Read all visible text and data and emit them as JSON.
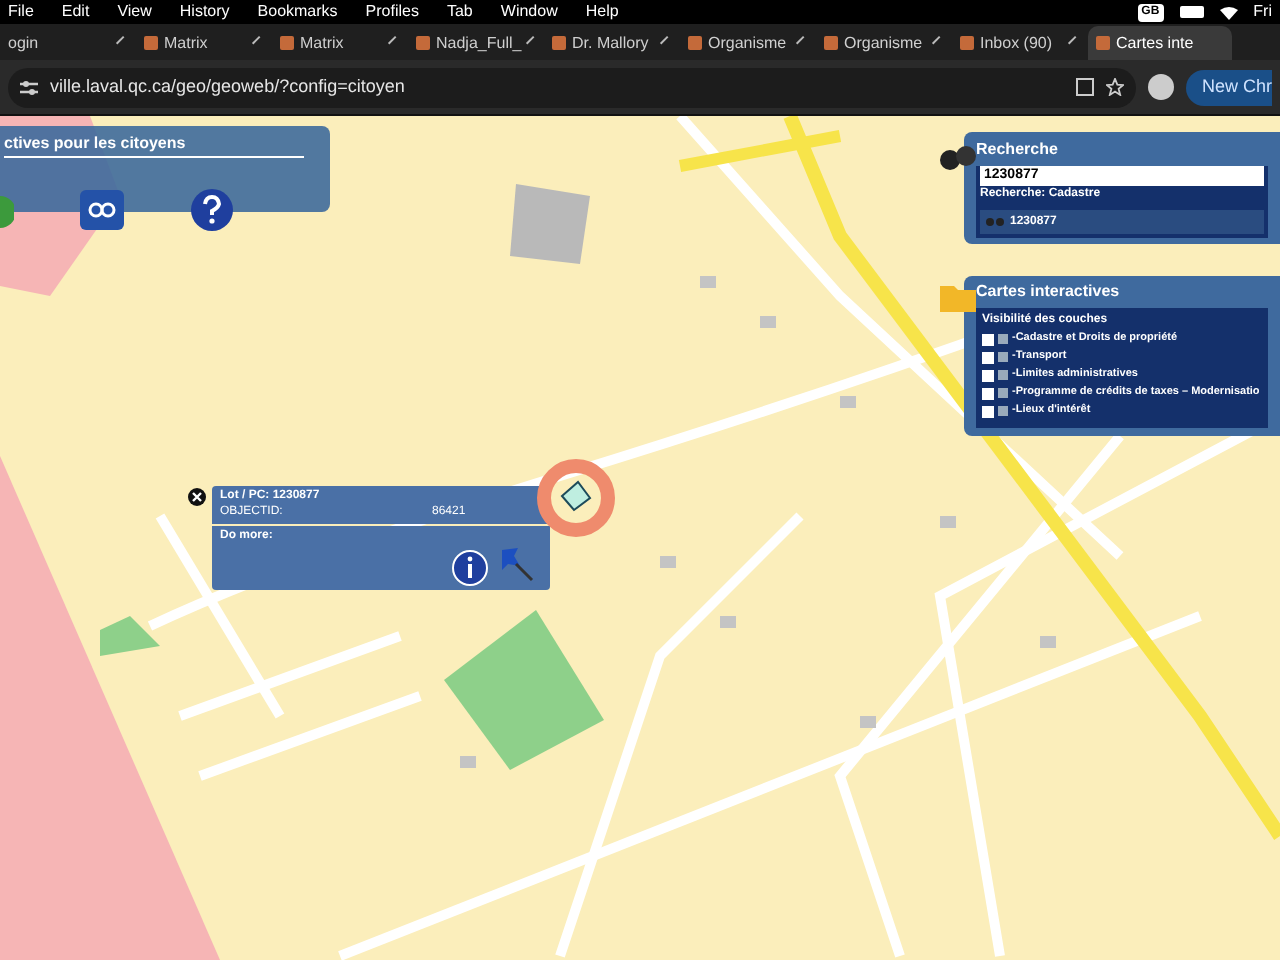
{
  "menu_bar": {
    "items": [
      "File",
      "Edit",
      "View",
      "History",
      "Bookmarks",
      "Profiles",
      "Tab",
      "Window",
      "Help"
    ],
    "input_source": "GB",
    "clock": "Fri"
  },
  "tabs": [
    {
      "label": "ogin",
      "selected": false
    },
    {
      "label": "Matrix",
      "selected": false
    },
    {
      "label": "Matrix",
      "selected": false
    },
    {
      "label": "Nadja_Full_",
      "selected": false
    },
    {
      "label": "Dr. Mallory",
      "selected": false
    },
    {
      "label": "Organisme",
      "selected": false
    },
    {
      "label": "Organisme",
      "selected": false
    },
    {
      "label": "Inbox (90)",
      "selected": false
    },
    {
      "label": "Cartes inte",
      "selected": true
    }
  ],
  "address_bar": {
    "url": "ville.laval.qc.ca/geo/geoweb/?config=citoyen",
    "new_button": "New Chr"
  },
  "app_title": "ctives pour les citoyens",
  "search_panel": {
    "title": "Recherche",
    "value": "1230877",
    "mode": "Recherche: Cadastre",
    "result": "1230877"
  },
  "layers_panel": {
    "title": "Cartes interactives",
    "subtitle": "Visibilité des couches",
    "layers": [
      {
        "label": "-Cadastre et Droits de propriété",
        "checked": false
      },
      {
        "label": "-Transport",
        "checked": false
      },
      {
        "label": "-Limites administratives",
        "checked": false
      },
      {
        "label": "-Programme de crédits de taxes – Modernisatio",
        "checked": false
      },
      {
        "label": "-Lieux d'intérêt",
        "checked": false
      }
    ]
  },
  "popup": {
    "title": "Lot / PC: 1230877",
    "field": "OBJECTID:",
    "value": "86421",
    "actions_label": "Do more:"
  }
}
